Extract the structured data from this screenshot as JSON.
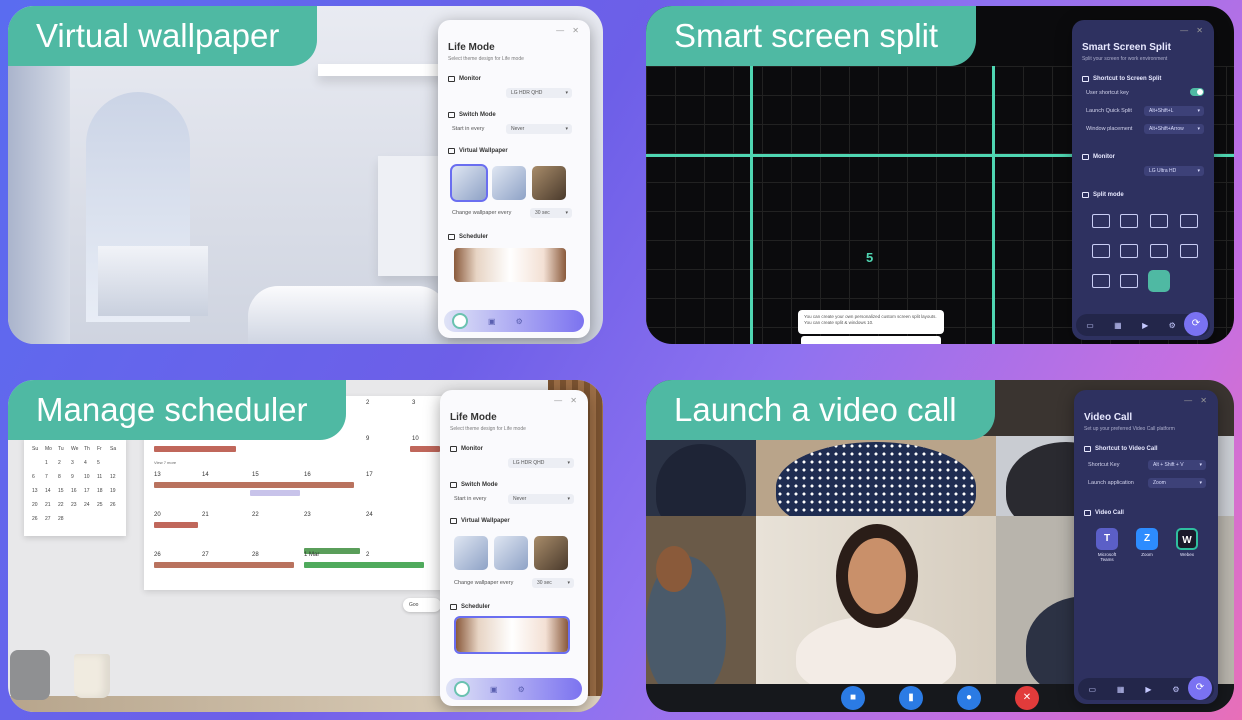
{
  "q1": {
    "banner": "Virtual wallpaper",
    "panel": {
      "title": "Life Mode",
      "subtitle": "Select theme design for Life mode",
      "monitor_label": "Monitor",
      "monitor_value": "LG HDR QHD",
      "switch_label": "Switch Mode",
      "start_label": "Start in every",
      "start_value": "Never",
      "vw_label": "Virtual Wallpaper",
      "change_label": "Change wallpaper every",
      "change_value": "30 sec",
      "scheduler_label": "Scheduler"
    }
  },
  "q2": {
    "banner": "Smart screen split",
    "zone_number": "5",
    "tooltip": "You can create your own personalized custom screen split layouts. You can create split & windows 10.",
    "panel": {
      "title": "Smart Screen Split",
      "subtitle": "Split your screen for work environment",
      "shortcut_label": "Shortcut to Screen Split",
      "user_key_label": "User shortcut key",
      "user_key_on": true,
      "quick_label": "Launch Quick Split",
      "quick_value": "Alt+Shift+L",
      "window_label": "Window placement",
      "window_value": "Alt+Shift+Arrow",
      "monitor_label": "Monitor",
      "monitor_value": "LG Ultra HD",
      "split_label": "Split mode"
    }
  },
  "q3": {
    "banner": "Manage scheduler",
    "calendar": {
      "dates_row1": [
        "2",
        "3"
      ],
      "dates_row2": [
        "9",
        "10"
      ],
      "dates_row3": [
        "13",
        "14",
        "15",
        "16",
        "17"
      ],
      "dates_row4": [
        "20",
        "21",
        "22",
        "23",
        "24"
      ],
      "dates_row5": [
        "26",
        "27",
        "28",
        "1 Mar",
        "2"
      ],
      "view_more": "View 7 more",
      "google_btn": "Goo"
    },
    "wall_calendar": {
      "rows": [
        [
          "Su",
          "Mo",
          "Tu",
          "We",
          "Th",
          "Fr",
          "Sa"
        ],
        [
          "",
          "1",
          "2",
          "3",
          "4",
          "5",
          ""
        ],
        [
          "6",
          "7",
          "8",
          "9",
          "10",
          "11",
          "12"
        ],
        [
          "13",
          "14",
          "15",
          "16",
          "17",
          "18",
          "19"
        ],
        [
          "20",
          "21",
          "22",
          "23",
          "24",
          "25",
          "26"
        ],
        [
          "26",
          "27",
          "28",
          "",
          "",
          "",
          ""
        ]
      ]
    },
    "panel": {
      "title": "Life Mode",
      "subtitle": "Select theme design for Life mode",
      "monitor_label": "Monitor",
      "monitor_value": "LG HDR QHD",
      "switch_label": "Switch Mode",
      "start_label": "Start in every",
      "start_value": "Never",
      "vw_label": "Virtual Wallpaper",
      "change_label": "Change wallpaper every",
      "change_value": "30 sec",
      "scheduler_label": "Scheduler"
    }
  },
  "q4": {
    "banner": "Launch a video call",
    "panel": {
      "title": "Video Call",
      "subtitle": "Set up your preferred Video Call platform",
      "shortcut_label": "Shortcut to Video Call",
      "key_label": "Shortcut Key",
      "key_value": "Alt + Shift + V",
      "launch_label": "Launch application",
      "launch_value": "Zoom",
      "vc_label": "Video Call",
      "apps": [
        "Microsoft Teams",
        "Zoom",
        "Webex"
      ]
    }
  },
  "colors": {
    "accent": "#4fb9a3",
    "panel_dark": "#2e3160",
    "brand": "#7a72f2"
  }
}
